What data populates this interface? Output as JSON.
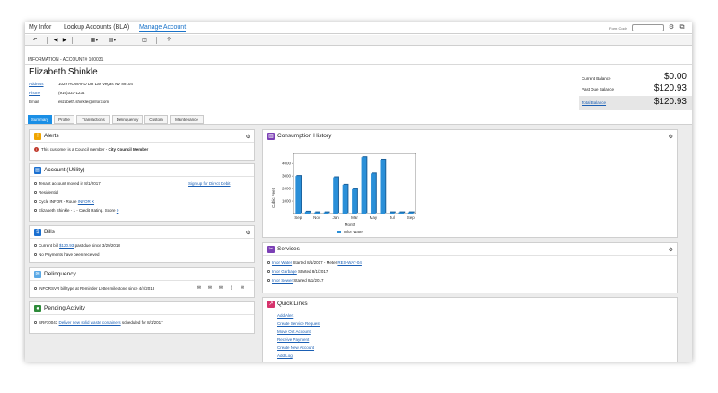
{
  "app_tabs": [
    {
      "label": "My Infor"
    },
    {
      "label": "Lookup Accounts (BLA)"
    },
    {
      "label": "Manage Account"
    }
  ],
  "form_code": {
    "label": "Form Code",
    "value": ""
  },
  "toolbar": {
    "back": "↶",
    "first": "◀",
    "next": "▶",
    "grid": "▦▾",
    "form": "▤▾",
    "view": "◫",
    "help": "?"
  },
  "info_bar": "INFORMATION - ACCOUNT# 100031",
  "customer": {
    "name": "Elizabeth Shinkle",
    "address_label": "Address",
    "address": "1029 HOWARD DR Las Vegas NV 89104",
    "phone_label": "Phone",
    "phone": "(916)333-1234",
    "email_label": "Email",
    "email": "elizabeth.shinkle@infor.com"
  },
  "balances": {
    "current_label": "Current Balance",
    "current": "$0.00",
    "past_due_label": "Past Due Balance",
    "past_due": "$120.93",
    "total_label": "Total Balance",
    "total": "$120.93"
  },
  "subtabs": [
    "Summary",
    "Profile",
    "Transactions",
    "Delinquency",
    "Custom",
    "Maintenance"
  ],
  "alerts": {
    "title": "Alerts",
    "message_prefix": "This customer is a Council member - ",
    "message_bold": "City Council Member"
  },
  "account": {
    "title": "Account (Utility)",
    "moved": "Tenant account moved in 8/1/2017",
    "direct_debit": "Sign up for Direct Debit",
    "residential": "Residential",
    "cycle": "Cycle  INFOR  - Route",
    "route_link": "INFOR X",
    "credit": "Elizabeth Shinkle  -  1 - Credit Rating. Score",
    "score": "0"
  },
  "bills": {
    "title": "Bills",
    "current_bill_prefix": "Current bill",
    "current_bill_amount": "$120.93",
    "current_bill_suffix": "past due since 3/29/2018",
    "no_payments": "No Payments have been received"
  },
  "delinquency": {
    "title": "Delinquency",
    "text": "INFORSVR bill type at Reminder Letter milestone since 4/4/2018"
  },
  "pending": {
    "title": "Pending Activity",
    "sr": "SR#70043",
    "link": "Deliver new solid waste containers",
    "suffix": "scheduled for 8/1/2017"
  },
  "consumption": {
    "title": "Consumption History",
    "ylabel": "Cubic Feet",
    "xlabel": "Month",
    "legend": "Infor Water",
    "color": "#2a8fd8"
  },
  "chart_data": {
    "type": "bar",
    "title": "Consumption History",
    "xlabel": "Month",
    "ylabel": "Cubic Feet",
    "ylim": [
      0,
      4800
    ],
    "yticks": [
      1000,
      2000,
      3000,
      4000
    ],
    "categories": [
      "Sep",
      "Oct",
      "Nov",
      "Dec",
      "Jan",
      "Feb",
      "Mar",
      "Apr",
      "May",
      "Jun",
      "Jul",
      "Aug",
      "Sep"
    ],
    "tick_labels": [
      "Sep",
      "Nov",
      "Jan",
      "Mar",
      "May",
      "Jul",
      "Sep"
    ],
    "series": [
      {
        "name": "Infor Water",
        "values": [
          3000,
          150,
          100,
          100,
          2900,
          2300,
          1950,
          4500,
          3200,
          4300,
          100,
          100,
          100
        ]
      }
    ],
    "grid": false,
    "legend_position": "bottom"
  },
  "services": {
    "title": "Services",
    "items": [
      {
        "link": "Infor Water",
        "text": "Started 8/1/2017   - Meter",
        "meter": "RES-WAT-04"
      },
      {
        "link": "Infor Garbage",
        "text": "Started 8/1/2017",
        "meter": ""
      },
      {
        "link": "Infor Sewer",
        "text": "Started 8/1/2017",
        "meter": ""
      }
    ]
  },
  "quick_links": {
    "title": "Quick Links",
    "items": [
      "Add Alert",
      "Create Service Request",
      "Move Out Account",
      "Receive Payment",
      "Create New Account",
      "Add Log"
    ]
  }
}
